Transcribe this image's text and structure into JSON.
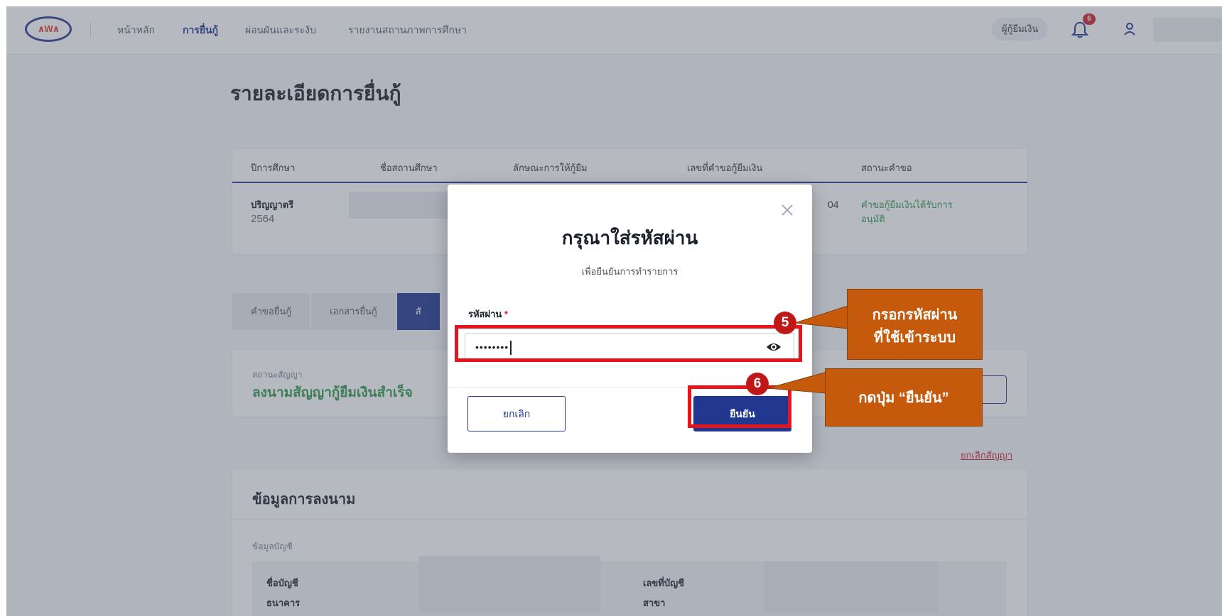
{
  "nav": {
    "items": [
      "หน้าหลัก",
      "การยื่นกู้",
      "ผ่อนผันและระงับ",
      "รายงานสถานภาพการศึกษา"
    ],
    "active_index": 1,
    "role": "ผู้กู้ยืมเงิน",
    "notification_count": "6"
  },
  "page": {
    "title": "รายละเอียดการยื่นกู้"
  },
  "info_table": {
    "headers": [
      "ปีการศึกษา",
      "ชื่อสถานศึกษา",
      "ลักษณะการให้กู้ยืม",
      "เลขที่คำขอกู้ยืมเงิน",
      "สถานะคำขอ"
    ],
    "level": "ปริญญาตรี",
    "year": "2564",
    "request_no_suffix": "04",
    "status_line1": "คำขอกู้ยืมเงินได้รับการ",
    "status_line2": "อนุมัติ"
  },
  "tabs": [
    "คำขอยื่นกู้",
    "เอกสารยื่นกู้",
    "สั"
  ],
  "contract": {
    "status_label": "สถานะสัญญา",
    "status_value": "ลงนามสัญญากู้ยืมเงินสำเร็จ",
    "cancel_link": "ยกเลิกสัญญา"
  },
  "signing": {
    "title": "ข้อมูลการลงนาม",
    "account_section": "ข้อมูลบัญชี",
    "account_name_label": "ชื่อบัญชี",
    "bank_label": "ธนาคาร",
    "account_no_label": "เลขที่บัญชี",
    "branch_label": "สาขา"
  },
  "modal": {
    "title": "กรุณาใส่รหัสผ่าน",
    "subtitle": "เพื่อยืนยันการทำรายการ",
    "password_label": "รหัสผ่าน",
    "required_mark": "*",
    "password_value": "••••••••",
    "cancel_label": "ยกเลิก",
    "confirm_label": "ยืนยัน"
  },
  "annotations": {
    "step5_number": "5",
    "step5_line1": "กรอกรหัสผ่าน",
    "step5_line2": "ที่ใช้เข้าระบบ",
    "step6_number": "6",
    "step6_text": "กดปุ่ม “ยืนยัน”",
    "highlight_color": "#e8141c",
    "callout_color": "#c55a0c"
  },
  "colors": {
    "brand": "#22378f",
    "success": "#2f9a4a",
    "danger": "#d0202a"
  }
}
